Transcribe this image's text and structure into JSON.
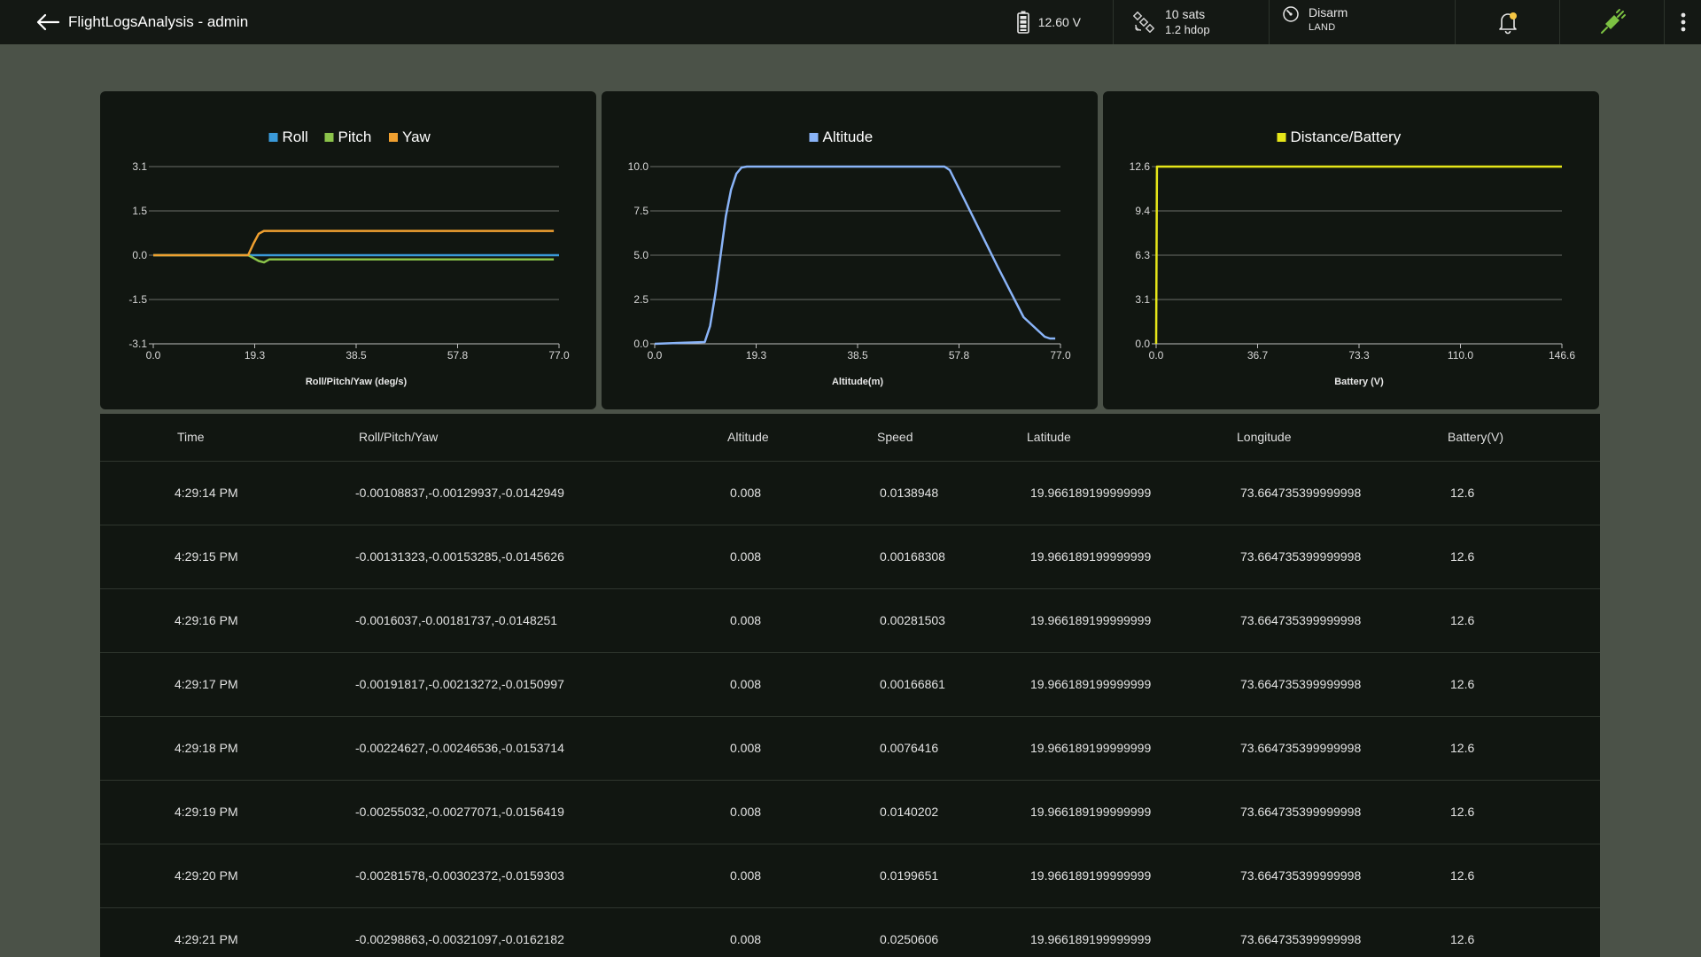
{
  "app": {
    "title": "FlightLogsAnalysis - admin"
  },
  "status": {
    "battery_voltage": "12.60 V",
    "gps_sats": "10 sats",
    "gps_hdop": "1.2 hdop",
    "arm_state": "Disarm",
    "flight_mode": "LAND"
  },
  "icons": {
    "back": "arrow-left-icon",
    "battery": "battery-icon",
    "gps": "satellite-icon",
    "arm": "arm-gauge-icon",
    "notifications": "bell-icon",
    "connection": "plug-connected-icon",
    "menu": "more-vertical-icon"
  },
  "colors": {
    "roll": "#3a9ad9",
    "pitch": "#8bc34a",
    "yaw": "#f0a030",
    "altitude": "#8ab4f8",
    "distance_battery": "#e6e619",
    "notification_dot": "#f5c542",
    "connected": "#7cc142"
  },
  "chart_data": [
    {
      "type": "line",
      "title": "",
      "xlabel": "Roll/Pitch/Yaw (deg/s)",
      "ylabel": "",
      "xlim": [
        0,
        77
      ],
      "ylim": [
        -3.1,
        3.1
      ],
      "x_ticks": [
        "0.0",
        "19.3",
        "38.5",
        "57.8",
        "77.0"
      ],
      "y_ticks": [
        "3.1",
        "1.5",
        "0.0",
        "-1.5",
        "-3.1"
      ],
      "grid": true,
      "legend": "top-center",
      "series": [
        {
          "name": "Roll",
          "color": "#3a9ad9",
          "x": [
            0,
            18,
            19.3,
            20,
            77
          ],
          "y": [
            0.0,
            0.0,
            0.0,
            0.0,
            0.0
          ]
        },
        {
          "name": "Pitch",
          "color": "#8bc34a",
          "x": [
            0,
            18,
            19,
            20,
            21,
            22,
            30,
            50,
            76
          ],
          "y": [
            0.0,
            0.0,
            -0.1,
            -0.2,
            -0.25,
            -0.15,
            -0.15,
            -0.15,
            -0.15
          ]
        },
        {
          "name": "Yaw",
          "color": "#f0a030",
          "x": [
            0,
            18,
            19,
            20,
            21,
            30,
            50,
            76
          ],
          "y": [
            0.0,
            0.0,
            0.4,
            0.75,
            0.85,
            0.85,
            0.85,
            0.85
          ]
        }
      ]
    },
    {
      "type": "line",
      "title": "",
      "xlabel": "Altitude(m)",
      "ylabel": "",
      "xlim": [
        0,
        77
      ],
      "ylim": [
        0,
        10
      ],
      "x_ticks": [
        "0.0",
        "19.3",
        "38.5",
        "57.8",
        "77.0"
      ],
      "y_ticks": [
        "10.0",
        "7.5",
        "5.0",
        "2.5",
        "0.0"
      ],
      "grid": true,
      "legend": "top-center",
      "series": [
        {
          "name": "Altitude",
          "color": "#8ab4f8",
          "x": [
            0,
            9.5,
            10.5,
            11.5,
            12.5,
            13.5,
            14.5,
            15.5,
            16.5,
            17.5,
            20,
            40,
            55,
            56,
            60,
            65,
            70,
            74,
            75,
            76
          ],
          "y": [
            0,
            0.1,
            1.0,
            2.8,
            5.0,
            7.2,
            8.7,
            9.6,
            9.95,
            10,
            10,
            10,
            10,
            9.8,
            7.4,
            4.4,
            1.5,
            0.4,
            0.3,
            0.3
          ]
        }
      ]
    },
    {
      "type": "line",
      "title": "",
      "xlabel": "Battery (V)",
      "ylabel": "",
      "xlim": [
        0,
        146.6
      ],
      "ylim": [
        0,
        12.6
      ],
      "x_ticks": [
        "0.0",
        "36.7",
        "73.3",
        "110.0",
        "146.6"
      ],
      "y_ticks": [
        "12.6",
        "9.4",
        "6.3",
        "3.1",
        "0.0"
      ],
      "grid": true,
      "legend": "top-center",
      "series": [
        {
          "name": "Distance/Battery",
          "color": "#e6e619",
          "x": [
            0,
            0.3,
            146.6
          ],
          "y": [
            0,
            12.6,
            12.6
          ]
        }
      ]
    }
  ],
  "table": {
    "columns": [
      "Time",
      "Roll/Pitch/Yaw",
      "Altitude",
      "Speed",
      "Latitude",
      "Longitude",
      "Battery(V)"
    ],
    "rows": [
      [
        "4:29:14 PM",
        "-0.00108837,-0.00129937,-0.0142949",
        "0.008",
        "0.0138948",
        "19.966189199999999",
        "73.664735399999998",
        "12.6"
      ],
      [
        "4:29:15 PM",
        "-0.00131323,-0.00153285,-0.0145626",
        "0.008",
        "0.00168308",
        "19.966189199999999",
        "73.664735399999998",
        "12.6"
      ],
      [
        "4:29:16 PM",
        "-0.0016037,-0.00181737,-0.0148251",
        "0.008",
        "0.00281503",
        "19.966189199999999",
        "73.664735399999998",
        "12.6"
      ],
      [
        "4:29:17 PM",
        "-0.00191817,-0.00213272,-0.0150997",
        "0.008",
        "0.00166861",
        "19.966189199999999",
        "73.664735399999998",
        "12.6"
      ],
      [
        "4:29:18 PM",
        "-0.00224627,-0.00246536,-0.0153714",
        "0.008",
        "0.0076416",
        "19.966189199999999",
        "73.664735399999998",
        "12.6"
      ],
      [
        "4:29:19 PM",
        "-0.00255032,-0.00277071,-0.0156419",
        "0.008",
        "0.0140202",
        "19.966189199999999",
        "73.664735399999998",
        "12.6"
      ],
      [
        "4:29:20 PM",
        "-0.00281578,-0.00302372,-0.0159303",
        "0.008",
        "0.0199651",
        "19.966189199999999",
        "73.664735399999998",
        "12.6"
      ],
      [
        "4:29:21 PM",
        "-0.00298863,-0.00321097,-0.0162182",
        "0.008",
        "0.0250606",
        "19.966189199999999",
        "73.664735399999998",
        "12.6"
      ]
    ]
  }
}
